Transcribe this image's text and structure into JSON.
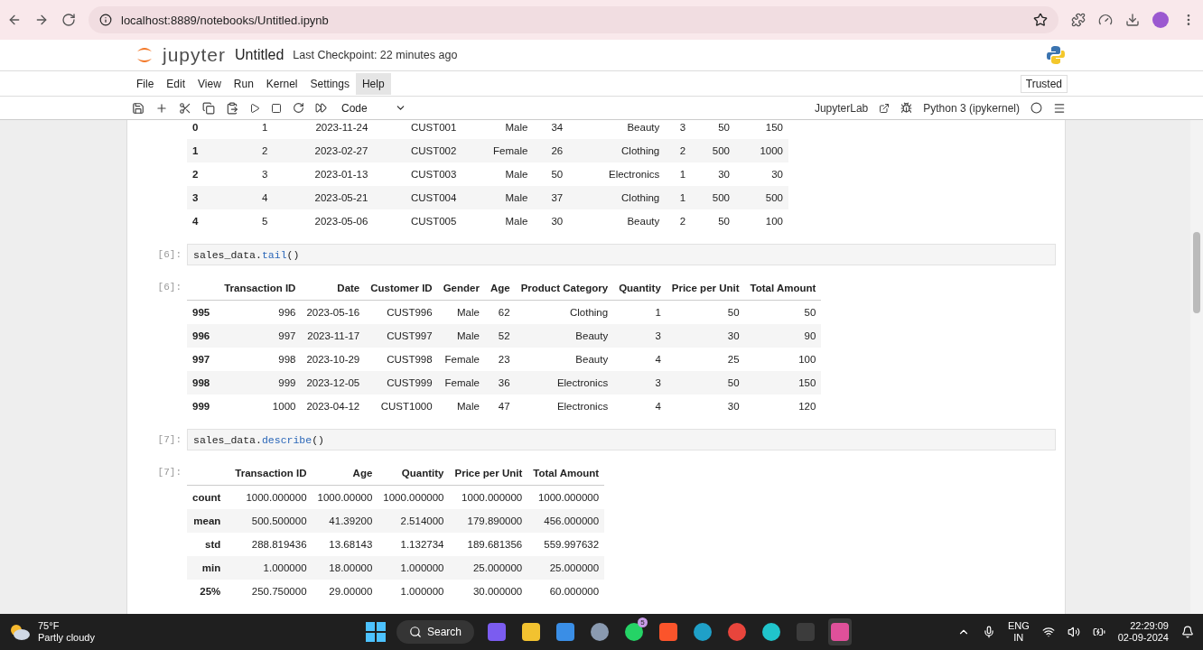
{
  "browser": {
    "url": "localhost:8889/notebooks/Untitled.ipynb"
  },
  "header": {
    "logo": "jupyter",
    "title": "Untitled",
    "checkpoint": "Last Checkpoint: 22 minutes ago",
    "trusted": "Trusted"
  },
  "menu": [
    {
      "label": "File",
      "selected": false
    },
    {
      "label": "Edit",
      "selected": false
    },
    {
      "label": "View",
      "selected": false
    },
    {
      "label": "Run",
      "selected": false
    },
    {
      "label": "Kernel",
      "selected": false
    },
    {
      "label": "Settings",
      "selected": false
    },
    {
      "label": "Help",
      "selected": true
    }
  ],
  "toolbar": {
    "cell_type": "Code",
    "lab_link": "JupyterLab",
    "kernel": "Python 3 (ipykernel)"
  },
  "cells": [
    {
      "kind": "output",
      "table": {
        "rows": [
          {
            "index": "0",
            "cells": [
              "1",
              "2023-11-24",
              "CUST001",
              "Male",
              "34",
              "Beauty",
              "3",
              "50",
              "150"
            ]
          },
          {
            "index": "1",
            "cells": [
              "2",
              "2023-02-27",
              "CUST002",
              "Female",
              "26",
              "Clothing",
              "2",
              "500",
              "1000"
            ]
          },
          {
            "index": "2",
            "cells": [
              "3",
              "2023-01-13",
              "CUST003",
              "Male",
              "50",
              "Electronics",
              "1",
              "30",
              "30"
            ]
          },
          {
            "index": "3",
            "cells": [
              "4",
              "2023-05-21",
              "CUST004",
              "Male",
              "37",
              "Clothing",
              "1",
              "500",
              "500"
            ]
          },
          {
            "index": "4",
            "cells": [
              "5",
              "2023-05-06",
              "CUST005",
              "Male",
              "30",
              "Beauty",
              "2",
              "50",
              "100"
            ]
          }
        ]
      }
    },
    {
      "kind": "code",
      "prompt": "[6]:",
      "tokens": [
        {
          "kind": "name",
          "text": "sales_data."
        },
        {
          "kind": "method",
          "text": "tail"
        },
        {
          "kind": "name",
          "text": "()"
        }
      ]
    },
    {
      "kind": "output",
      "prompt": "[6]:",
      "table": {
        "columns": [
          "Transaction ID",
          "Date",
          "Customer ID",
          "Gender",
          "Age",
          "Product Category",
          "Quantity",
          "Price per Unit",
          "Total Amount"
        ],
        "rows": [
          {
            "index": "995",
            "cells": [
              "996",
              "2023-05-16",
              "CUST996",
              "Male",
              "62",
              "Clothing",
              "1",
              "50",
              "50"
            ]
          },
          {
            "index": "996",
            "cells": [
              "997",
              "2023-11-17",
              "CUST997",
              "Male",
              "52",
              "Beauty",
              "3",
              "30",
              "90"
            ]
          },
          {
            "index": "997",
            "cells": [
              "998",
              "2023-10-29",
              "CUST998",
              "Female",
              "23",
              "Beauty",
              "4",
              "25",
              "100"
            ]
          },
          {
            "index": "998",
            "cells": [
              "999",
              "2023-12-05",
              "CUST999",
              "Female",
              "36",
              "Electronics",
              "3",
              "50",
              "150"
            ]
          },
          {
            "index": "999",
            "cells": [
              "1000",
              "2023-04-12",
              "CUST1000",
              "Male",
              "47",
              "Electronics",
              "4",
              "30",
              "120"
            ]
          }
        ]
      }
    },
    {
      "kind": "code",
      "prompt": "[7]:",
      "tokens": [
        {
          "kind": "name",
          "text": "sales_data."
        },
        {
          "kind": "method",
          "text": "describe"
        },
        {
          "kind": "name",
          "text": "()"
        }
      ]
    },
    {
      "kind": "output",
      "prompt": "[7]:",
      "table": {
        "columns": [
          "Transaction ID",
          "Age",
          "Quantity",
          "Price per Unit",
          "Total Amount"
        ],
        "rows": [
          {
            "index": "count",
            "cells": [
              "1000.000000",
              "1000.00000",
              "1000.000000",
              "1000.000000",
              "1000.000000"
            ]
          },
          {
            "index": "mean",
            "cells": [
              "500.500000",
              "41.39200",
              "2.514000",
              "179.890000",
              "456.000000"
            ]
          },
          {
            "index": "std",
            "cells": [
              "288.819436",
              "13.68143",
              "1.132734",
              "189.681356",
              "559.997632"
            ]
          },
          {
            "index": "min",
            "cells": [
              "1.000000",
              "18.00000",
              "1.000000",
              "25.000000",
              "25.000000"
            ]
          },
          {
            "index": "25%",
            "cells": [
              "250.750000",
              "29.00000",
              "1.000000",
              "30.000000",
              "60.000000"
            ]
          }
        ]
      }
    }
  ],
  "taskbar": {
    "temperature": "75°F",
    "weather": "Partly cloudy",
    "search": "Search",
    "apps": [
      {
        "kind": "copilot",
        "color": "#7b5cf0",
        "active": false
      },
      {
        "kind": "folder",
        "color": "#f2c230",
        "active": false
      },
      {
        "kind": "store",
        "color": "#3a8ee6",
        "active": false
      },
      {
        "kind": "settings",
        "color": "#8a9ab0",
        "active": false
      },
      {
        "kind": "whatsapp",
        "color": "#25d366",
        "badge": "5",
        "active": false
      },
      {
        "kind": "brave",
        "color": "#fb542b",
        "active": false
      },
      {
        "kind": "edge",
        "color": "#1fa0c8",
        "active": false
      },
      {
        "kind": "chrome",
        "color": "#e8453c",
        "active": false
      },
      {
        "kind": "canva",
        "color": "#20c4cb",
        "active": false
      },
      {
        "kind": "terminal",
        "color": "#3c3c3c",
        "active": false
      },
      {
        "kind": "snip",
        "color": "#e0509a",
        "active": true
      }
    ],
    "language": "ENG",
    "region": "IN",
    "time": "22:29:09",
    "date": "02-09-2024"
  }
}
